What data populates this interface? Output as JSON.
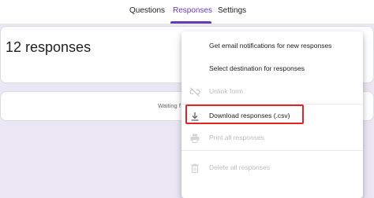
{
  "tabs": [
    {
      "label": "Questions",
      "active": false
    },
    {
      "label": "Responses",
      "active": true
    },
    {
      "label": "Settings",
      "active": false
    }
  ],
  "summary": {
    "count_label": "12 responses"
  },
  "waiting": {
    "text": "Waiting f"
  },
  "menu": {
    "items": [
      {
        "label": "Get email notifications for new responses",
        "icon": null,
        "disabled": false
      },
      {
        "label": "Select destination for responses",
        "icon": null,
        "disabled": false
      },
      {
        "label": "Unlink form",
        "icon": "link-off-icon",
        "disabled": true
      },
      {
        "label": "Download responses (.csv)",
        "icon": "download-icon",
        "disabled": false,
        "highlighted": true
      },
      {
        "label": "Print all responses",
        "icon": "print-icon",
        "disabled": true
      },
      {
        "label": "Delete all responses",
        "icon": "trash-icon",
        "disabled": true
      }
    ]
  },
  "colors": {
    "accent": "#673ab7",
    "background": "#ece7f5",
    "highlight_border": "#e02424",
    "disabled_text": "#b9bcc0"
  }
}
